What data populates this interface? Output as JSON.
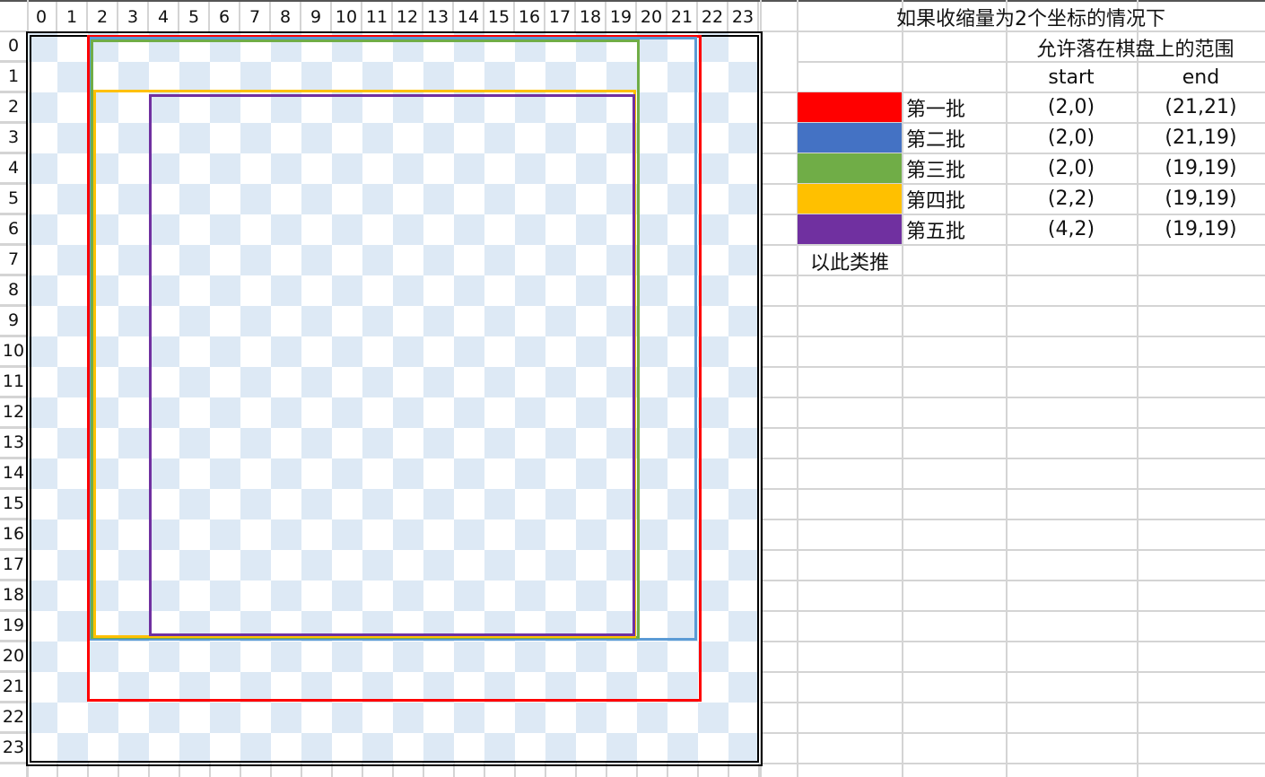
{
  "column_headers": [
    "0",
    "1",
    "2",
    "3",
    "4",
    "5",
    "6",
    "7",
    "8",
    "9",
    "10",
    "11",
    "12",
    "13",
    "14",
    "15",
    "16",
    "17",
    "18",
    "19",
    "20",
    "21",
    "22",
    "23"
  ],
  "row_headers": [
    "0",
    "1",
    "2",
    "3",
    "4",
    "5",
    "6",
    "7",
    "8",
    "9",
    "10",
    "11",
    "12",
    "13",
    "14",
    "15",
    "16",
    "17",
    "18",
    "19",
    "20",
    "21",
    "22",
    "23"
  ],
  "colors": {
    "checker_blue": "#dde9f5",
    "gridline": "#d4d4d4"
  },
  "legend": {
    "title": "如果收缩量为2个坐标的情况下",
    "subtitle": "允许落在棋盘上的范围",
    "start_header": "start",
    "end_header": "end",
    "batches": [
      {
        "label": "第一批",
        "color": "#ff0000",
        "start": "(2,0)",
        "end": "(21,21)"
      },
      {
        "label": "第二批",
        "color": "#4472c4",
        "start": "(2,0)",
        "end": "(21,19)"
      },
      {
        "label": "第三批",
        "color": "#70ad47",
        "start": "(2,0)",
        "end": "(19,19)"
      },
      {
        "label": "第四批",
        "color": "#ffc000",
        "start": "(2,2)",
        "end": "(19,19)"
      },
      {
        "label": "第五批",
        "color": "#7030a0",
        "start": "(4,2)",
        "end": "(19,19)"
      }
    ],
    "etc": "以此类推"
  }
}
